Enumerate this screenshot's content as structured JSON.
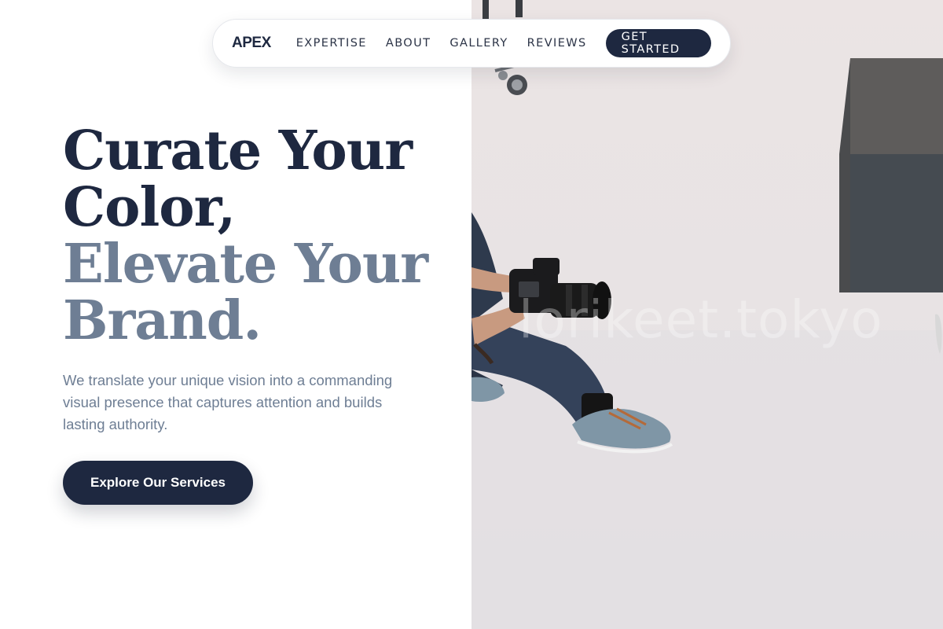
{
  "nav": {
    "brand": "APEX",
    "links": [
      "EXPERTISE",
      "ABOUT",
      "GALLERY",
      "REVIEWS"
    ],
    "cta": "GET STARTED"
  },
  "hero": {
    "title_dark": [
      "Curate Your",
      "Color,"
    ],
    "title_muted": [
      "Elevate Your",
      "Brand."
    ],
    "subtitle": "We translate your unique vision into a commanding visual presence that captures attention and builds lasting authority.",
    "cta": "Explore Our Services"
  },
  "photo": {
    "watermark": "lorikeet.tokyo"
  },
  "colors": {
    "navy": "#1e2840",
    "slate": "#6e7e94",
    "background": "#ffffff"
  }
}
